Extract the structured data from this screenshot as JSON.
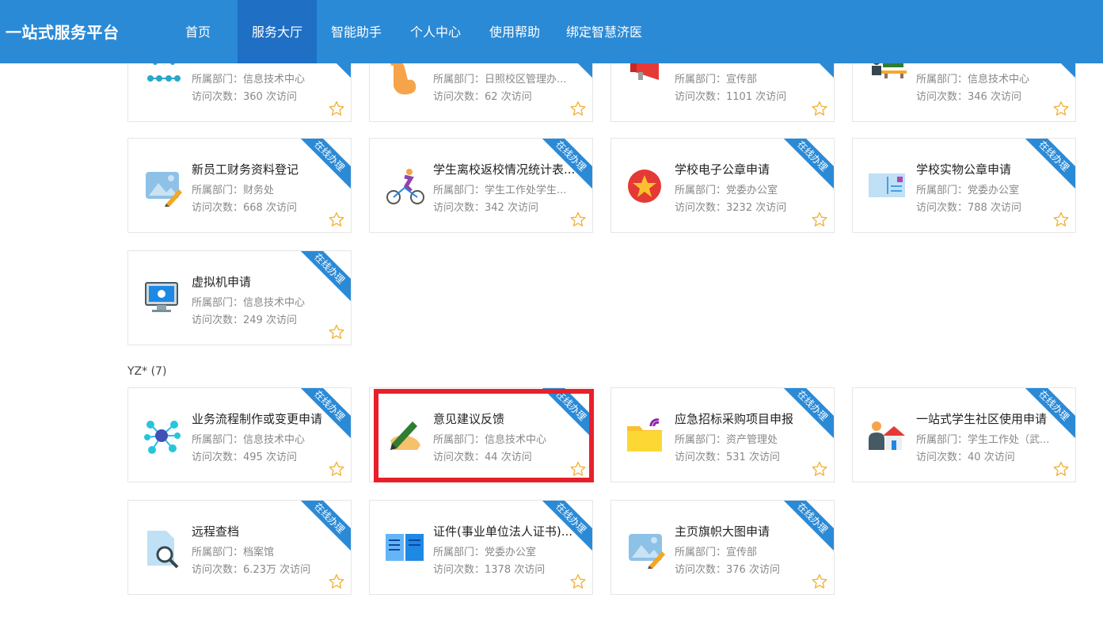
{
  "nav": {
    "brand": "一站式服务平台",
    "items": [
      "首页",
      "服务大厅",
      "智能助手",
      "个人中心",
      "使用帮助",
      "绑定智慧济医"
    ],
    "active_index": 1
  },
  "ribbon_label": "在线办理",
  "dept_prefix": "所属部门：",
  "visits_prefix": "访问次数：",
  "visits_suffix": " 次访问",
  "colors": {
    "nav_bg": "#2b8ad6",
    "nav_active": "#1f6fc5",
    "ribbon": "#2b8ad6",
    "highlight": "#e8202a",
    "star": "#f3b33d"
  },
  "top_cards": [
    {
      "title": "",
      "dept": "信息技术中心",
      "visits": "360",
      "icon": "network-dots-icon"
    },
    {
      "title": "",
      "dept": "日照校区管理办...",
      "visits": "62",
      "icon": "pointing-hand-icon"
    },
    {
      "title": "",
      "dept": "宣传部",
      "visits": "1101",
      "icon": "megaphone-icon"
    },
    {
      "title": "",
      "dept": "信息技术中心",
      "visits": "346",
      "icon": "classroom-icon"
    },
    {
      "title": "新员工财务资料登记",
      "dept": "财务处",
      "visits": "668",
      "icon": "image-edit-icon"
    },
    {
      "title": "学生离校返校情况统计表...",
      "dept": "学生工作处学生...",
      "visits": "342",
      "icon": "cyclist-icon"
    },
    {
      "title": "学校电子公章申请",
      "dept": "党委办公室",
      "visits": "3232",
      "icon": "red-star-seal-icon"
    },
    {
      "title": "学校实物公章申请",
      "dept": "党委办公室",
      "visits": "788",
      "icon": "postcard-icon"
    },
    {
      "title": "虚拟机申请",
      "dept": "信息技术中心",
      "visits": "249",
      "icon": "monitor-icon"
    }
  ],
  "group": {
    "title": "YZ* (7)"
  },
  "group_cards": [
    {
      "title": "业务流程制作或变更申请",
      "dept": "信息技术中心",
      "visits": "495",
      "icon": "hub-nodes-icon"
    },
    {
      "title": "意见建议反馈",
      "dept": "信息技术中心",
      "visits": "44",
      "icon": "hand-writing-icon"
    },
    {
      "title": "应急招标采购项目申报",
      "dept": "资产管理处",
      "visits": "531",
      "icon": "folder-signal-icon"
    },
    {
      "title": "一站式学生社区使用申请",
      "dept": "学生工作处（武...",
      "visits": "40",
      "icon": "person-house-icon"
    },
    {
      "title": "远程查档",
      "dept": "档案馆",
      "visits": "6.23万",
      "icon": "document-search-icon"
    },
    {
      "title": "证件(事业单位法人证书)...",
      "dept": "党委办公室",
      "visits": "1378",
      "icon": "open-book-icon"
    },
    {
      "title": "主页旗帜大图申请",
      "dept": "宣传部",
      "visits": "376",
      "icon": "image-edit-icon"
    }
  ]
}
